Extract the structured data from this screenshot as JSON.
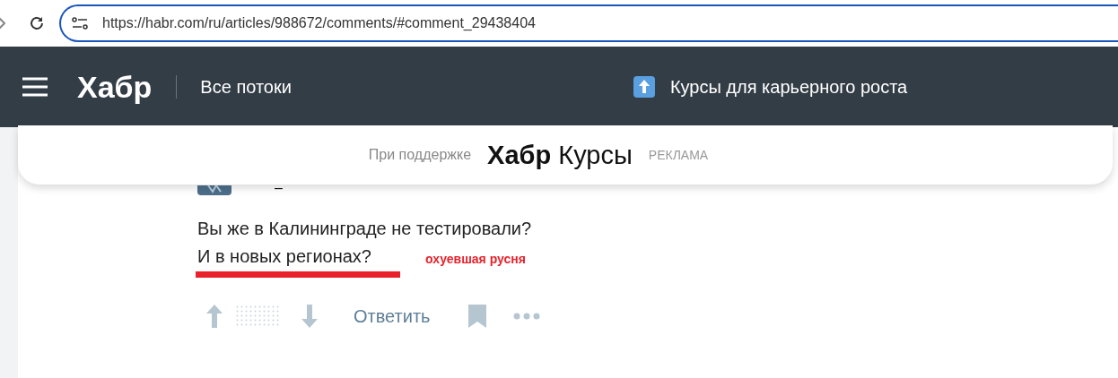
{
  "browser": {
    "url": "https://habr.com/ru/articles/988672/comments/#comment_29438404"
  },
  "header": {
    "logo": "Хабр",
    "nav": "Все потоки",
    "promo": "Курсы для карьерного роста"
  },
  "sponsor": {
    "label": "При поддержке",
    "brand_bold": "Хабр",
    "brand_rest": "Курсы",
    "ad": "РЕКЛАМА"
  },
  "comment": {
    "author": "–",
    "lines": [
      "Вы же в Калининграде не тестировали?",
      "И в новых регионах?"
    ],
    "annotation": "охуевшая русня",
    "reply": "Ответить"
  }
}
